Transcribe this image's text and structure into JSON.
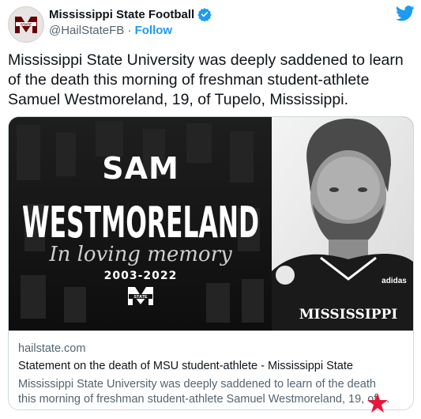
{
  "account": {
    "display_name": "Mississippi State Football",
    "handle": "@HailStateFB",
    "separator": "·",
    "follow_label": "Follow"
  },
  "tweet": {
    "text": "Mississippi State University was deeply saddened to learn of the death this morning of freshman student-athlete Samuel Westmoreland, 19, of Tupelo, Mississippi."
  },
  "card": {
    "graphic": {
      "first_name": "SAM",
      "last_name": "WESTMORELAND",
      "script_line": "In loving memory",
      "years": "2003-2022",
      "jersey_text": "MISSISSIPPI",
      "jersey_brand": "adidas",
      "logo_text": "STATE"
    },
    "domain": "hailstate.com",
    "title": "Statement on the death of MSU student-athlete - Mississippi State",
    "description_line1": "Mississippi State University was deeply saddened to learn of the death",
    "description_line2": "this morning of freshman student-athlete Samuel Westmoreland, 19, of ..."
  },
  "colors": {
    "twitter_blue": "#1d9bf0",
    "msu_maroon": "#660000",
    "text_primary": "#0f1419",
    "text_secondary": "#536471"
  }
}
